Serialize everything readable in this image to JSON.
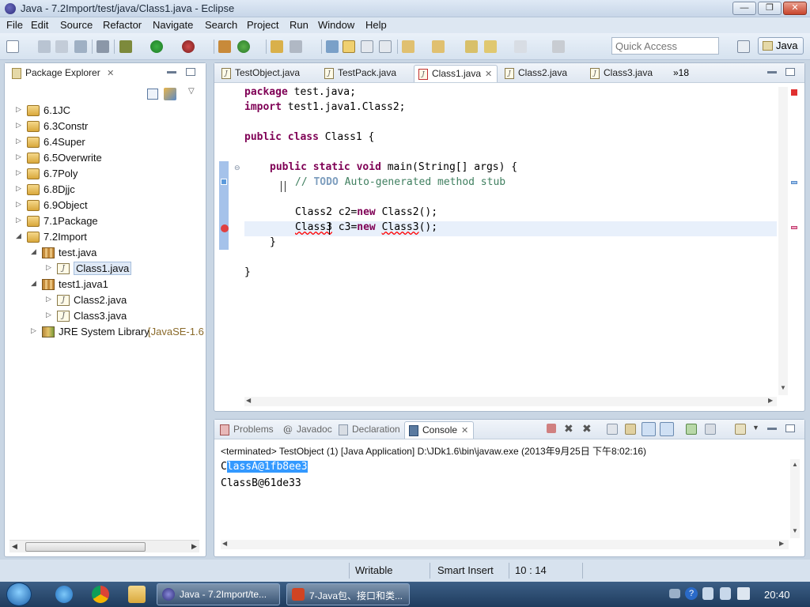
{
  "window": {
    "title": "Java - 7.2Import/test/java/Class1.java - Eclipse",
    "min": "—",
    "max": "❐",
    "close": "✕"
  },
  "menu": [
    "File",
    "Edit",
    "Source",
    "Refactor",
    "Navigate",
    "Search",
    "Project",
    "Run",
    "Window",
    "Help"
  ],
  "toolbar": {
    "quick_access_placeholder": "Quick Access",
    "perspective": "Java"
  },
  "package_explorer": {
    "title": "Package Explorer",
    "items": [
      {
        "label": "6.1JC",
        "type": "project",
        "depth": 0,
        "arrow": "▷"
      },
      {
        "label": "6.3Constr",
        "type": "project",
        "depth": 0,
        "arrow": "▷"
      },
      {
        "label": "6.4Super",
        "type": "project",
        "depth": 0,
        "arrow": "▷"
      },
      {
        "label": "6.5Overwrite",
        "type": "project",
        "depth": 0,
        "arrow": "▷"
      },
      {
        "label": "6.7Poly",
        "type": "project",
        "depth": 0,
        "arrow": "▷"
      },
      {
        "label": "6.8Djjc",
        "type": "project",
        "depth": 0,
        "arrow": "▷"
      },
      {
        "label": "6.9Object",
        "type": "project",
        "depth": 0,
        "arrow": "▷"
      },
      {
        "label": "7.1Package",
        "type": "project",
        "depth": 0,
        "arrow": "▷"
      },
      {
        "label": "7.2Import",
        "type": "project",
        "depth": 0,
        "arrow": "◢"
      },
      {
        "label": "test.java",
        "type": "package",
        "depth": 1,
        "arrow": "◢"
      },
      {
        "label": "Class1.java",
        "type": "java",
        "depth": 2,
        "arrow": "▷",
        "selected": true
      },
      {
        "label": "test1.java1",
        "type": "package",
        "depth": 1,
        "arrow": "◢"
      },
      {
        "label": "Class2.java",
        "type": "java",
        "depth": 2,
        "arrow": "▷"
      },
      {
        "label": "Class3.java",
        "type": "java",
        "depth": 2,
        "arrow": "▷"
      },
      {
        "label": "JRE System Library",
        "suffix": "[JavaSE-1.6",
        "type": "library",
        "depth": 1,
        "arrow": "▷"
      }
    ]
  },
  "editor": {
    "tabs": [
      {
        "label": "TestObject.java",
        "active": false
      },
      {
        "label": "TestPack.java",
        "active": false
      },
      {
        "label": "Class1.java",
        "active": true
      },
      {
        "label": "Class2.java",
        "active": false
      },
      {
        "label": "Class3.java",
        "active": false
      }
    ],
    "overflow": "»18",
    "code": {
      "l1_kw": "package",
      "l1_rest": " test.java;",
      "l2_kw": "import",
      "l2_rest": " test1.java1.Class2;",
      "l4_kw1": "public",
      "l4_kw2": "class",
      "l4_rest": " Class1 {",
      "l6_kw1": "public",
      "l6_kw2": "static",
      "l6_kw3": "void",
      "l6_rest": " main(String[] args) {",
      "l7_cm1": "// ",
      "l7_todo": "TODO",
      "l7_cm2": " Auto-generated method stub",
      "l9_a": "Class2 c2=",
      "l9_kw": "new",
      "l9_b": " Class2();",
      "l10_err1": "Class3",
      "l10_mid": " c3=",
      "l10_kw": "new",
      "l10_sp": " ",
      "l10_err2": "Class3",
      "l10_end": "();",
      "l11": "}",
      "l13": "}"
    }
  },
  "console_view": {
    "tabs": [
      "Problems",
      "Javadoc",
      "Declaration",
      "Console"
    ],
    "active_tab": "Console",
    "header": "<terminated> TestObject (1) [Java Application] D:\\JDk1.6\\bin\\javaw.exe (2013年9月25日 下午8:02:16)",
    "line1_first": "C",
    "line1_selected": "lassA@1fb8ee3",
    "line2": "ClassB@61de33"
  },
  "status": {
    "writable": "Writable",
    "insert_mode": "Smart Insert",
    "position": "10 : 14"
  },
  "taskbar": {
    "items": [
      {
        "label": "Java - 7.2Import/te..."
      },
      {
        "label": "7-Java包、接口和类..."
      }
    ],
    "clock": "20:40"
  }
}
